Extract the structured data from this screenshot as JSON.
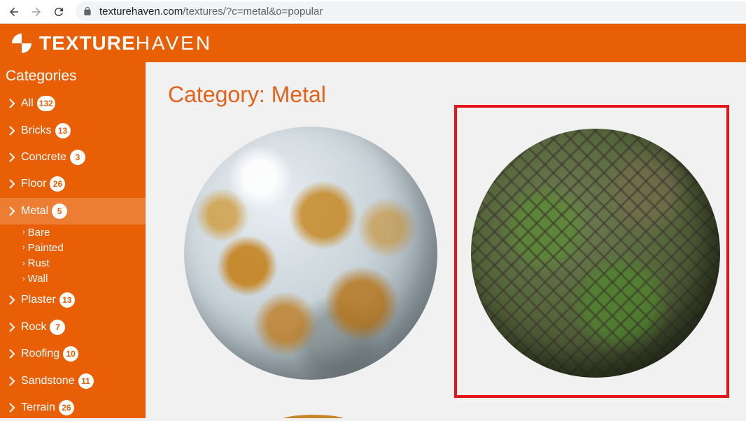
{
  "browser": {
    "url_host": "texturehaven.com",
    "url_path": "/textures/?c=metal&o=popular"
  },
  "site": {
    "logo_bold": "TEXTURE",
    "logo_thin": "HAVEN"
  },
  "sidebar": {
    "title": "Categories",
    "items": [
      {
        "label": "All",
        "count": "132"
      },
      {
        "label": "Bricks",
        "count": "13"
      },
      {
        "label": "Concrete",
        "count": "3"
      },
      {
        "label": "Floor",
        "count": "26"
      },
      {
        "label": "Metal",
        "count": "5",
        "active": true
      },
      {
        "label": "Plaster",
        "count": "13"
      },
      {
        "label": "Rock",
        "count": "7"
      },
      {
        "label": "Roofing",
        "count": "10"
      },
      {
        "label": "Sandstone",
        "count": "11"
      },
      {
        "label": "Terrain",
        "count": "26"
      }
    ],
    "subitems": [
      "Bare",
      "Painted",
      "Rust",
      "Wall"
    ]
  },
  "main": {
    "title": "Category: Metal"
  },
  "colors": {
    "brand": "#e85f05",
    "highlight": "#e8141c"
  }
}
